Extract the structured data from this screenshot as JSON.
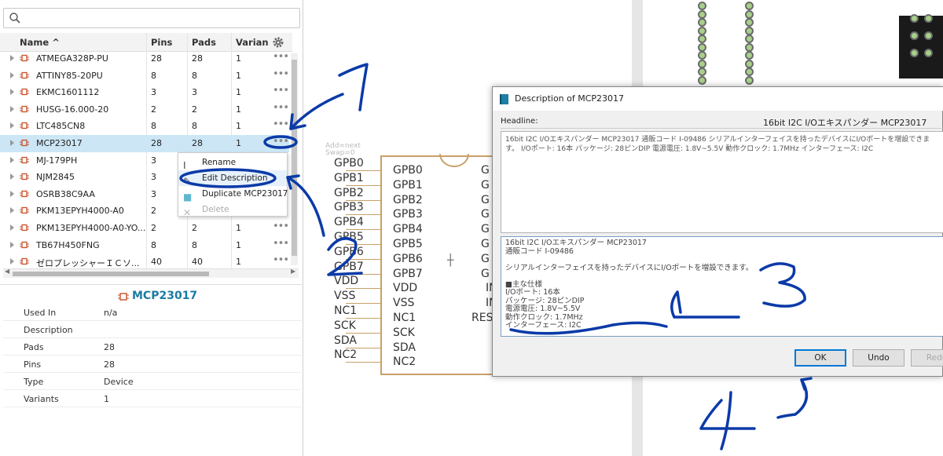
{
  "search": {
    "placeholder": ""
  },
  "columns": {
    "name": "Name",
    "pins": "Pins",
    "pads": "Pads",
    "variants": "Varian"
  },
  "parts": [
    {
      "name": "ATMEGA328P-PU",
      "pins": "28",
      "pads": "28",
      "variants": "1",
      "dots": "•••"
    },
    {
      "name": "ATTINY85-20PU",
      "pins": "8",
      "pads": "8",
      "variants": "1",
      "dots": "•••"
    },
    {
      "name": "EKMC1601112",
      "pins": "3",
      "pads": "3",
      "variants": "1",
      "dots": "•••"
    },
    {
      "name": "HUSG-16.000-20",
      "pins": "2",
      "pads": "2",
      "variants": "1",
      "dots": "•••"
    },
    {
      "name": "LTC485CN8",
      "pins": "8",
      "pads": "8",
      "variants": "1",
      "dots": "•••"
    },
    {
      "name": "MCP23017",
      "pins": "28",
      "pads": "28",
      "variants": "1",
      "dots": "•••",
      "selected": true
    },
    {
      "name": "MJ-179PH",
      "pins": "3",
      "pads": "",
      "variants": "",
      "dots": ""
    },
    {
      "name": "NJM2845",
      "pins": "3",
      "pads": "",
      "variants": "",
      "dots": ""
    },
    {
      "name": "OSRB38C9AA",
      "pins": "3",
      "pads": "",
      "variants": "",
      "dots": ""
    },
    {
      "name": "PKM13EPYH4000-A0",
      "pins": "2",
      "pads": "",
      "variants": "",
      "dots": ""
    },
    {
      "name": "PKM13EPYH4000-A0-YO...",
      "pins": "2",
      "pads": "2",
      "variants": "1",
      "dots": "•••"
    },
    {
      "name": "TB67H450FNG",
      "pins": "8",
      "pads": "8",
      "variants": "1",
      "dots": "•••"
    },
    {
      "name": "ゼロプレッシャーＩＣソ...",
      "pins": "40",
      "pads": "40",
      "variants": "1",
      "dots": "•••"
    }
  ],
  "context_menu": {
    "rename": "Rename",
    "edit_description": "Edit Description",
    "duplicate": "Duplicate MCP23017",
    "delete": "Delete"
  },
  "details": {
    "title": "MCP23017",
    "rows": [
      {
        "label": "Used In",
        "value": "n/a"
      },
      {
        "label": "Description",
        "value": ""
      },
      {
        "label": "Pads",
        "value": "28"
      },
      {
        "label": "Pins",
        "value": "28"
      },
      {
        "label": "Type",
        "value": "Device"
      },
      {
        "label": "Variants",
        "value": "1"
      }
    ]
  },
  "schematic": {
    "ghost_add": "Add=next",
    "ghost_swap": "Swap=0",
    "left_pins": [
      "GPB0",
      "GPB1",
      "GPB2",
      "GPB3",
      "GPB4",
      "GPB5",
      "GPB6",
      "GPB7",
      "VDD",
      "VSS",
      "NC1",
      "SCK",
      "SDA",
      "NC2"
    ],
    "inner_pins": [
      "GPB0",
      "GPB1",
      "GPB2",
      "GPB3",
      "GPB4",
      "GPB5",
      "GPB6",
      "GPB7",
      "VDD",
      "VSS",
      "NC1",
      "SCK",
      "SDA",
      "NC2"
    ],
    "right_pins": [
      "G",
      "G",
      "G",
      "G",
      "G",
      "G",
      "G",
      "G",
      "IN",
      "IN",
      "RES"
    ]
  },
  "dialog": {
    "title": "Description of MCP23017",
    "headline_label": "Headline:",
    "headline_value": "16bit I2C I/Oエキスパンダー MCP23017",
    "preview_text": "16bit I2C I/Oエキスパンダー MCP23017 通販コード I-09486 シリアルインターフェイスを持ったデバイスにI/Oポートを増設できます。 I/Oポート: 16本 パッケージ: 28ピンDIP 電源電圧: 1.8V~5.5V 動作クロック: 1.7MHz インターフェース: I2C",
    "edit_lines": [
      "16bit I2C I/Oエキスパンダー MCP23017",
      "通販コード I-09486",
      "",
      "シリアルインターフェイスを持ったデバイスにI/Oポートを増設できます。",
      "",
      "■主な仕様",
      "I/Oポート: 16本",
      "パッケージ: 28ピンDIP",
      "電源電圧: 1.8V~5.5V",
      "動作クロック: 1.7MHz",
      "インターフェース: I2C"
    ],
    "ok": "OK",
    "undo": "Undo",
    "redo": "Redo"
  },
  "annotations": {
    "n1": "1",
    "n2": "2",
    "n3": "3",
    "n4": "4"
  },
  "colors": {
    "annotation_ink": "#0b3aa8",
    "selection": "#cce6f5",
    "accent": "#1b7aa3",
    "symbol": "#c8a068"
  }
}
